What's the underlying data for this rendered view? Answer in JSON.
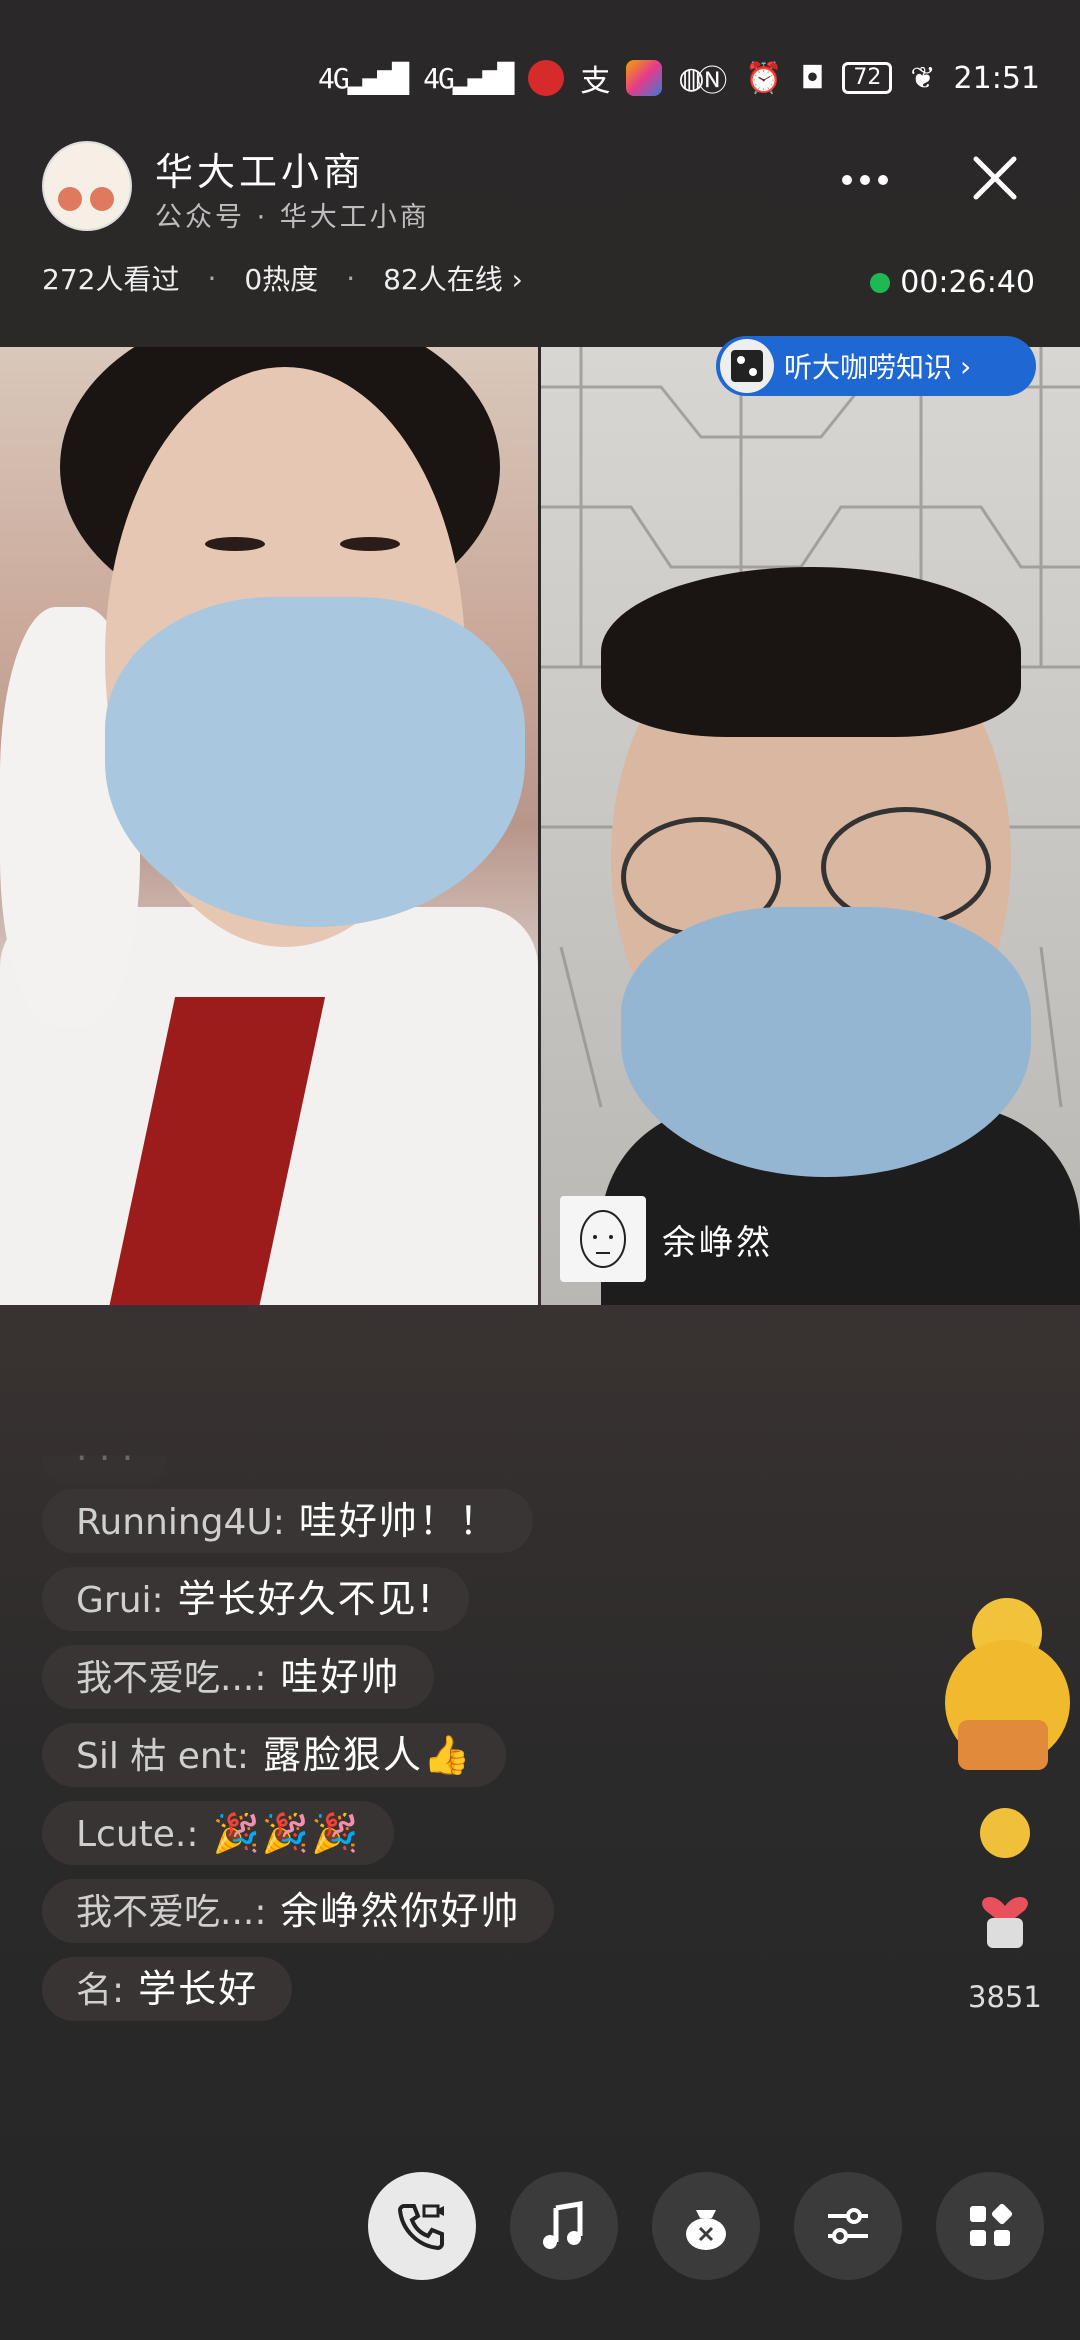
{
  "status_bar": {
    "network": [
      "4G",
      "4G"
    ],
    "battery": "72",
    "time": "21:51"
  },
  "header": {
    "title": "华大工小商",
    "subtitle": "公众号 · 华大工小商"
  },
  "stats": {
    "viewed": "272人看过",
    "heat": "0热度",
    "online": "82人在线 ›",
    "duration": "00:26:40"
  },
  "topic_pill": {
    "label": "听大咖唠知识"
  },
  "guest": {
    "name": "余峥然"
  },
  "comments": [
    {
      "user": "Running4U:",
      "msg": "哇好帅！！"
    },
    {
      "user": "Grui:",
      "msg": "学长好久不见!"
    },
    {
      "user": "我不爱吃...:",
      "msg": "哇好帅"
    },
    {
      "user": "Sil 枯 ent:",
      "msg": "露脸狠人👍"
    },
    {
      "user": "Lcute.:",
      "msg": "🎉🎉🎉"
    },
    {
      "user": "我不爱吃...:",
      "msg": "余峥然你好帅"
    },
    {
      "user": "名:",
      "msg": "学长好"
    }
  ],
  "likes": {
    "count": "3851"
  },
  "colors": {
    "accent_blue": "#1f67d2",
    "live_green": "#1db954"
  }
}
